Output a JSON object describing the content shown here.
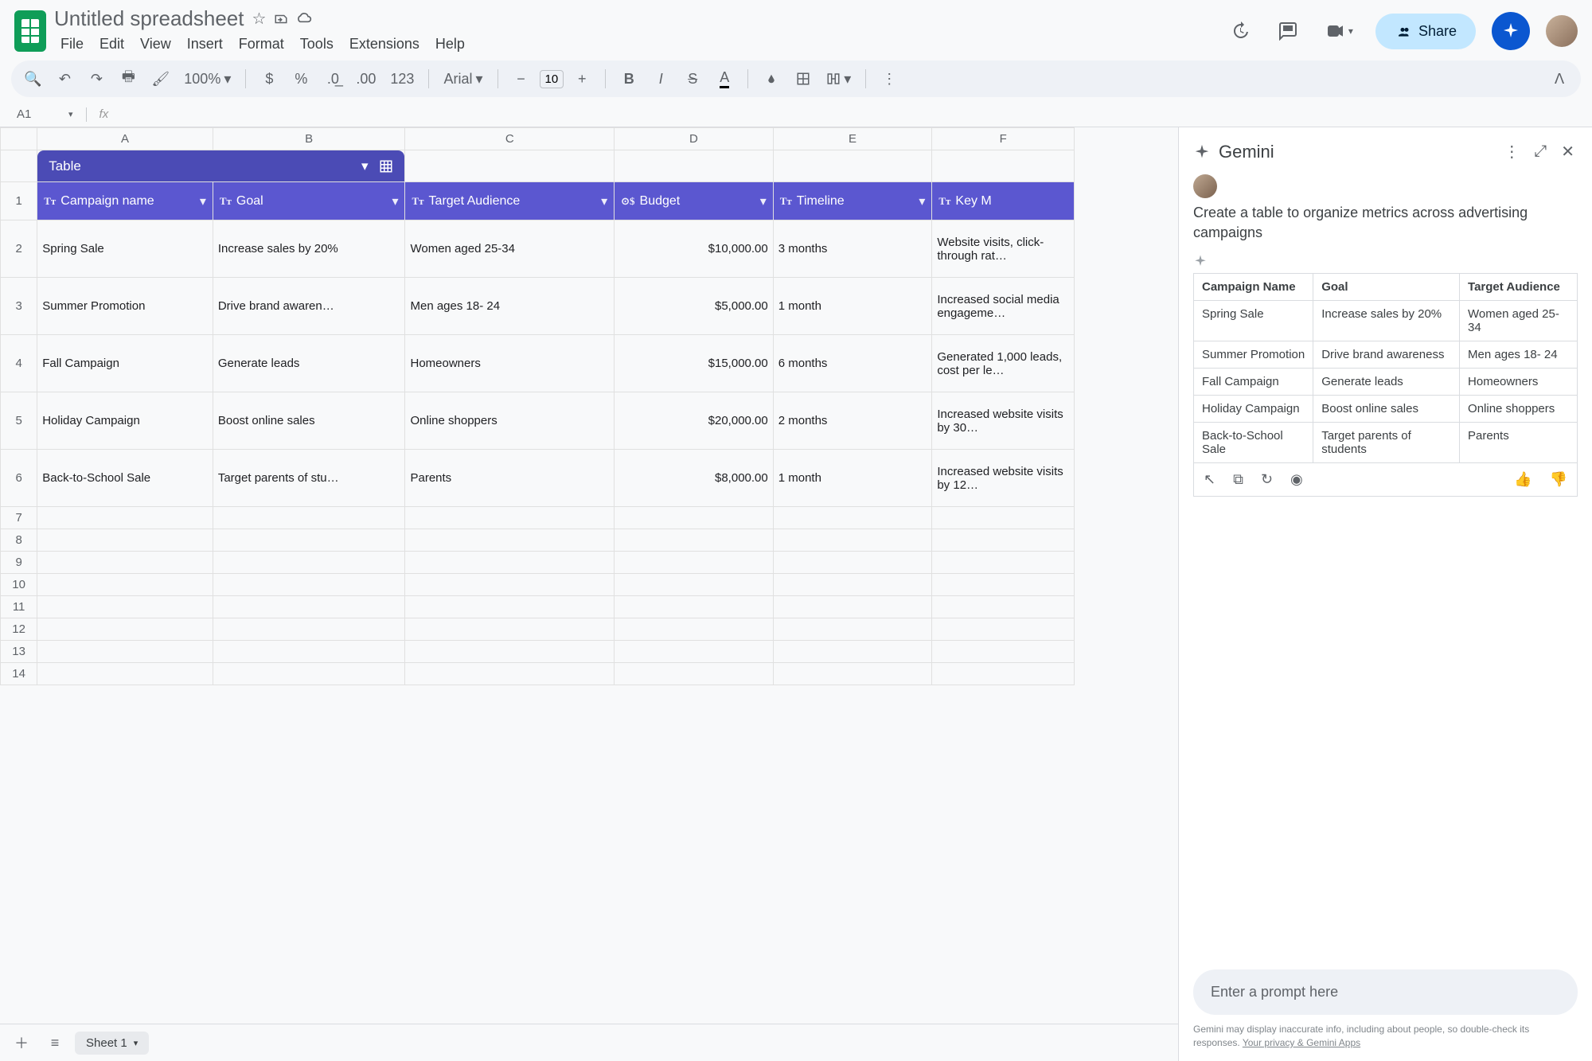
{
  "doc": {
    "title": "Untitled spreadsheet"
  },
  "menubar": [
    "File",
    "Edit",
    "View",
    "Insert",
    "Format",
    "Tools",
    "Extensions",
    "Help"
  ],
  "toolbar": {
    "zoom": "100%",
    "font": "Arial",
    "fontSize": "10",
    "share": "Share"
  },
  "formula": {
    "cell": "A1"
  },
  "columns": [
    "A",
    "B",
    "C",
    "D",
    "E",
    "F"
  ],
  "tableChip": {
    "label": "Table"
  },
  "headers": {
    "campaign": "Campaign name",
    "goal": "Goal",
    "audience": "Target Audience",
    "budget": "Budget",
    "timeline": "Timeline",
    "key": "Key M"
  },
  "budgetIcon": "$",
  "rows": [
    {
      "n": "2",
      "campaign": "Spring Sale",
      "goal": "Increase sales by 20%",
      "audience": "Women aged 25-34",
      "budget": "$10,000.00",
      "timeline": "3 months",
      "key": "Website visits, click-through rat…"
    },
    {
      "n": "3",
      "campaign": "Summer Promotion",
      "goal": "Drive brand awaren…",
      "audience": "Men ages 18- 24",
      "budget": "$5,000.00",
      "timeline": "1 month",
      "key": "Increased social media engageme…"
    },
    {
      "n": "4",
      "campaign": "Fall Campaign",
      "goal": "Generate leads",
      "audience": "Homeowners",
      "budget": "$15,000.00",
      "timeline": "6 months",
      "key": "Generated 1,000 leads, cost per le…"
    },
    {
      "n": "5",
      "campaign": "Holiday Campaign",
      "goal": "Boost online sales",
      "audience": "Online shoppers",
      "budget": "$20,000.00",
      "timeline": "2 months",
      "key": "Increased website visits by 30…"
    },
    {
      "n": "6",
      "campaign": "Back-to-School Sale",
      "goal": "Target parents of stu…",
      "audience": "Parents",
      "budget": "$8,000.00",
      "timeline": "1 month",
      "key": "Increased website visits by 12…"
    }
  ],
  "emptyRows": [
    "7",
    "8",
    "9",
    "10",
    "11",
    "12",
    "13",
    "14"
  ],
  "sheetTab": {
    "name": "Sheet 1"
  },
  "gemini": {
    "title": "Gemini",
    "prompt": "Create a table to organize metrics across advertising campaigns",
    "placeholder": "Enter a prompt here",
    "disclaimer": "Gemini may display inaccurate info, including about people, so double-check its responses. ",
    "disclaimerLink": "Your privacy & Gemini Apps",
    "table": {
      "headers": {
        "c1": "Campaign Name",
        "c2": "Goal",
        "c3": "Target Audience"
      },
      "rows": [
        {
          "c1": "Spring Sale",
          "c2": "Increase sales by 20%",
          "c3": "Women aged 25-34"
        },
        {
          "c1": "Summer Promotion",
          "c2": "Drive brand awareness",
          "c3": "Men ages 18- 24"
        },
        {
          "c1": "Fall Campaign",
          "c2": "Generate leads",
          "c3": "Homeowners"
        },
        {
          "c1": "Holiday Campaign",
          "c2": "Boost online sales",
          "c3": "Online shoppers"
        },
        {
          "c1": "Back-to-School Sale",
          "c2": "Target parents of students",
          "c3": "Parents"
        }
      ]
    }
  }
}
